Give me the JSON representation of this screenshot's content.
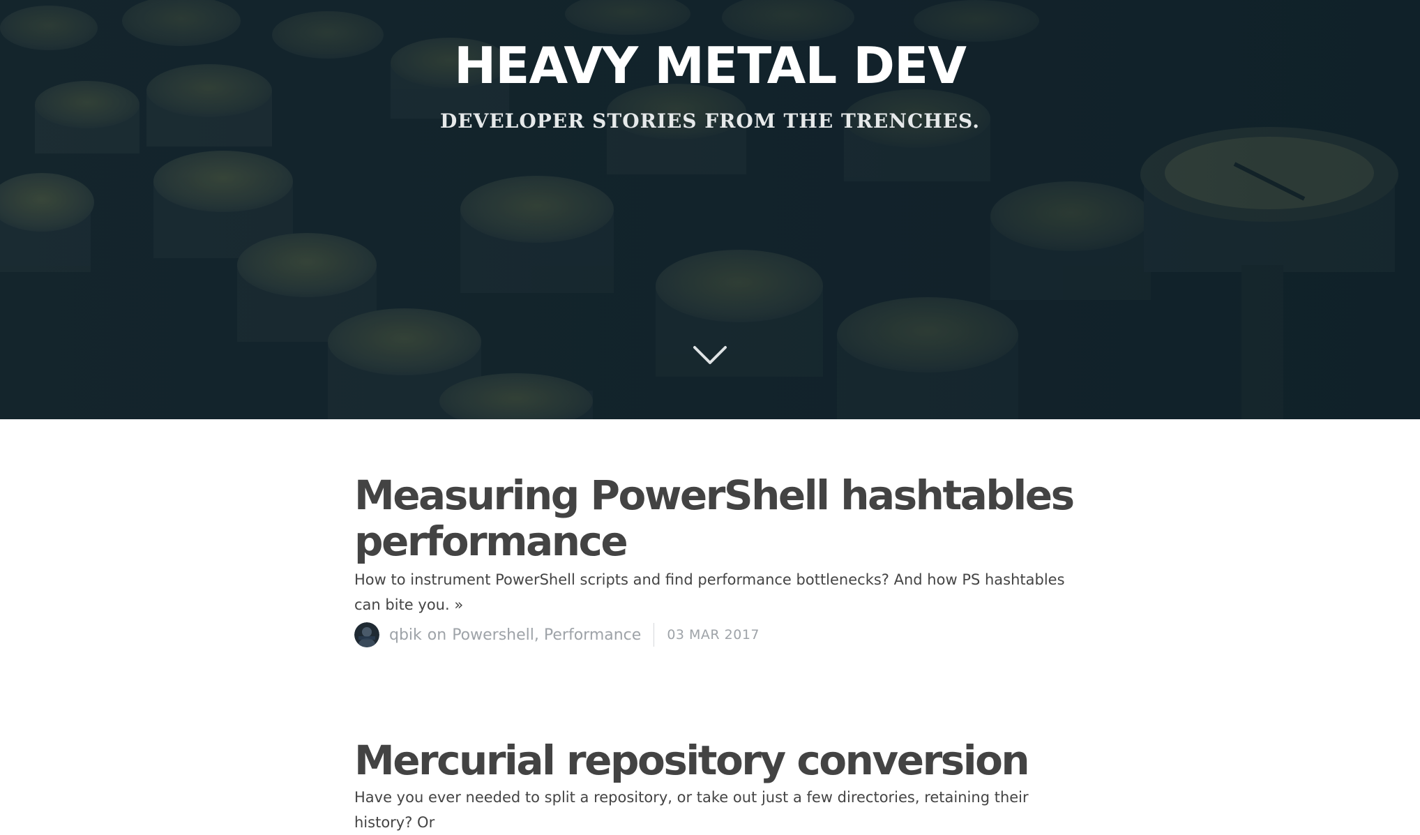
{
  "blog": {
    "title": "HEAVY METAL DEV",
    "description": "DEVELOPER STORIES FROM THE TRENCHES."
  },
  "posts": [
    {
      "title": "Measuring PowerShell hashtables performance",
      "excerpt": "How to instrument PowerShell scripts and find performance bottlenecks? And how PS hashtables can bite you.",
      "more": "»",
      "author": "qbik",
      "on": "on",
      "tags": [
        "Powershell",
        "Performance"
      ],
      "tag_separator": ",",
      "date": "03 MAR 2017"
    },
    {
      "title": "Mercurial repository conversion",
      "excerpt": "Have you ever needed to split a repository, or take out just a few directories, retaining their history? Or"
    }
  ],
  "icons": {
    "scroll_down": "chevron-down-icon",
    "avatar": "user-avatar"
  },
  "colors": {
    "hero_bg": "#17232b",
    "title_text": "#434343",
    "body_text": "#444444",
    "meta_text": "#9ea3a8"
  }
}
